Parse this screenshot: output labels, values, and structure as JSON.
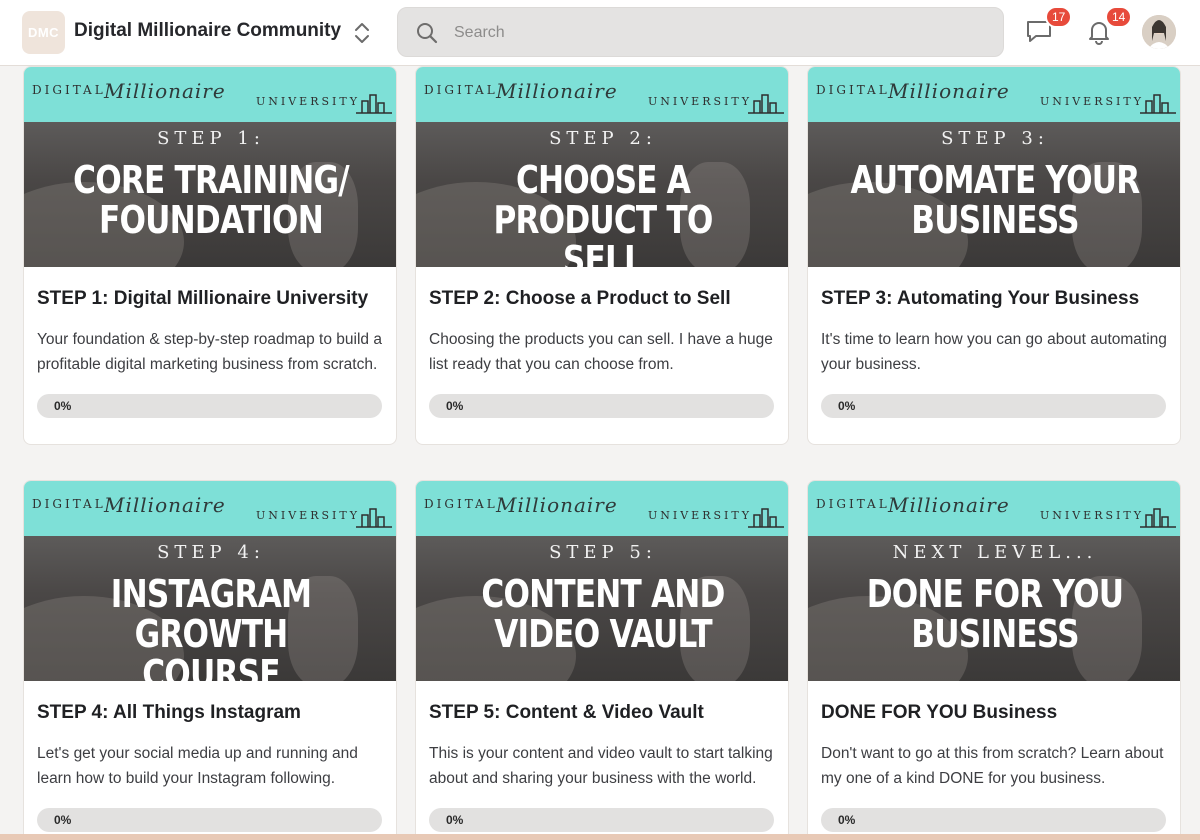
{
  "header": {
    "logo_text": "DMC",
    "community_name": "Digital Millionaire Community",
    "search_placeholder": "Search",
    "messages_count": "17",
    "notifications_count": "14",
    "accent_color": "#e74a3b"
  },
  "banner": {
    "left_text": "DIGITAL",
    "script_text": "Millionaire",
    "right_text": "UNIVERSITY",
    "color": "#7ee0d7"
  },
  "courses": [
    {
      "image_kicker": "STEP 1:",
      "image_title": "CORE TRAINING/ FOUNDATION",
      "title": "STEP 1: Digital Millionaire University",
      "description": "Your foundation & step-by-step roadmap to build a profitable digital marketing business from scratch.",
      "progress_label": "0%",
      "progress": 0
    },
    {
      "image_kicker": "STEP 2:",
      "image_title": "CHOOSE A PRODUCT TO SELL",
      "title": "STEP 2: Choose a Product to Sell",
      "description": "Choosing the products you can sell. I have a huge list ready that you can choose from.",
      "progress_label": "0%",
      "progress": 0
    },
    {
      "image_kicker": "STEP 3:",
      "image_title": "AUTOMATE YOUR BUSINESS",
      "title": "STEP 3: Automating Your Business",
      "description": "It's time to learn how you can go about automating your business.",
      "progress_label": "0%",
      "progress": 0
    },
    {
      "image_kicker": "STEP 4:",
      "image_title": "INSTAGRAM GROWTH COURSE",
      "title": "STEP 4: All Things Instagram",
      "description": "Let's get your social media up and running and learn how to build your Instagram following.",
      "progress_label": "0%",
      "progress": 0
    },
    {
      "image_kicker": "STEP 5:",
      "image_title": "CONTENT AND VIDEO VAULT",
      "title": "STEP 5: Content & Video Vault",
      "description": "This is your content and video vault to start talking about and sharing your business with the world.",
      "progress_label": "0%",
      "progress": 0
    },
    {
      "image_kicker": "NEXT LEVEL...",
      "image_title": "DONE FOR YOU BUSINESS",
      "title": "DONE FOR YOU Business",
      "description": "Don't want to go at this from scratch? Learn about my one of a kind DONE for you business.",
      "progress_label": "0%",
      "progress": 0
    }
  ]
}
